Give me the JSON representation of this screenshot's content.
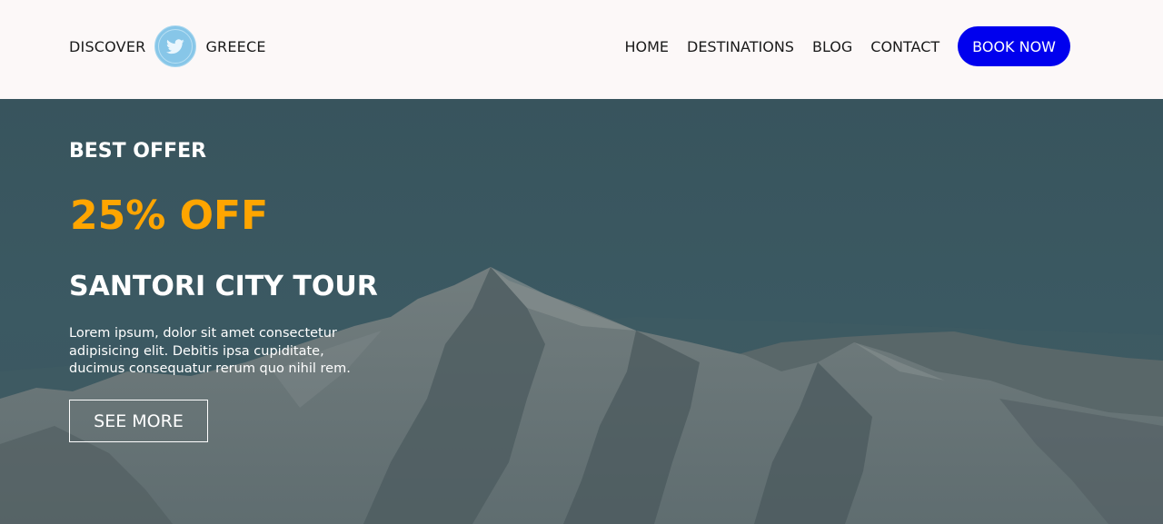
{
  "header": {
    "brand": {
      "word_left": "DISCOVER",
      "word_right": "GREECE",
      "logo_icon": "twitter-bird-icon"
    },
    "nav": {
      "items": [
        {
          "label": "HOME"
        },
        {
          "label": "DESTINATIONS"
        },
        {
          "label": "BLOG"
        },
        {
          "label": "CONTACT"
        }
      ],
      "cta_label": "BOOK NOW"
    }
  },
  "hero": {
    "eyebrow": "BEST OFFER",
    "discount": "25% OFF",
    "title": "SANTORI CITY TOUR",
    "description": "Lorem ipsum, dolor sit amet consectetur adipisicing elit. Debitis ipsa cupiditate, ducimus consequatur rerum quo nihil rem.",
    "cta_label": "SEE MORE",
    "background_image": "snowy-mountain-range"
  },
  "colors": {
    "header_bg": "#fcf8f8",
    "accent_blue": "#0000ee",
    "discount_orange": "#ffa500",
    "logo_blue": "#87c6e8",
    "hero_overlay": "#3a5760"
  }
}
